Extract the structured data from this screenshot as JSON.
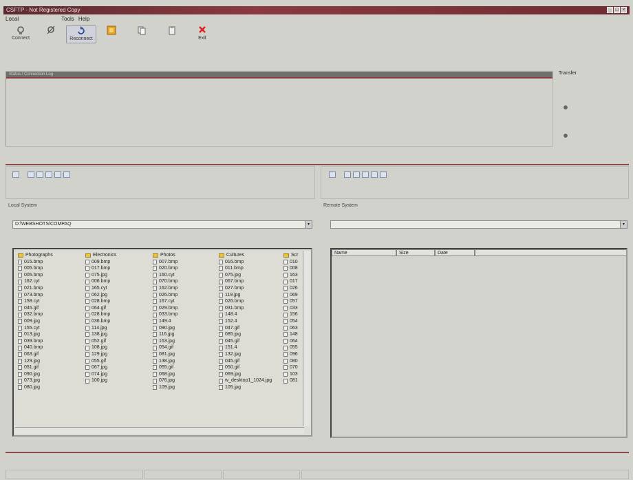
{
  "window": {
    "title": "CSFTP - Not Registered Copy"
  },
  "menu": [
    "Local",
    "Tools",
    "Help"
  ],
  "toolbar": [
    {
      "label": "Connect",
      "icon": "connect-icon"
    },
    {
      "label": "",
      "icon": "disconnect-icon"
    },
    {
      "label": "Reconnect",
      "icon": "reconnect-icon"
    },
    {
      "label": "",
      "icon": "stop-icon"
    },
    {
      "label": "",
      "icon": "copy-icon"
    },
    {
      "label": "",
      "icon": "paste-icon"
    },
    {
      "label": "Exit",
      "icon": "exit-icon"
    }
  ],
  "status": {
    "header": "Status / Connection Log"
  },
  "transfer": {
    "label": "Transfer"
  },
  "local": {
    "label": "Local System",
    "path": "D:\\WEBSHOTS\\COMPAQ",
    "columns": [
      {
        "items": [
          {
            "name": "Photographs",
            "type": "folder"
          },
          {
            "name": "015.bmp"
          },
          {
            "name": "005.bmp"
          },
          {
            "name": "005.bmp"
          },
          {
            "name": "162.cyt"
          },
          {
            "name": "021.bmp"
          },
          {
            "name": "073.bmp"
          },
          {
            "name": "158.cyt"
          },
          {
            "name": "045.gif"
          },
          {
            "name": "032.bmp"
          },
          {
            "name": "009.jpg"
          },
          {
            "name": "155.cyt"
          },
          {
            "name": "013.jpg"
          },
          {
            "name": "039.bmp"
          },
          {
            "name": "040.bmp"
          },
          {
            "name": "063.gif"
          },
          {
            "name": "129.jpg"
          },
          {
            "name": "051.gif"
          },
          {
            "name": "090.jpg"
          },
          {
            "name": "073.jpg"
          },
          {
            "name": "080.jpg"
          }
        ]
      },
      {
        "items": [
          {
            "name": "Electronics",
            "type": "folder"
          },
          {
            "name": "009.bmp"
          },
          {
            "name": "017.bmp"
          },
          {
            "name": "075.jpg"
          },
          {
            "name": "006.bmp"
          },
          {
            "name": "165.cyt"
          },
          {
            "name": "062.jpg"
          },
          {
            "name": "028.bmp"
          },
          {
            "name": "064.gif"
          },
          {
            "name": "028.bmp"
          },
          {
            "name": "036.bmp"
          },
          {
            "name": "114.jpg"
          },
          {
            "name": "138.jpg"
          },
          {
            "name": "052.gif"
          },
          {
            "name": "108.jpg"
          },
          {
            "name": "129.jpg"
          },
          {
            "name": "055.gif"
          },
          {
            "name": "067.jpg"
          },
          {
            "name": "074.jpg"
          },
          {
            "name": "100.jpg"
          }
        ]
      },
      {
        "items": [
          {
            "name": "Photos",
            "type": "folder"
          },
          {
            "name": "007.bmp"
          },
          {
            "name": "020.bmp"
          },
          {
            "name": "160.cyt"
          },
          {
            "name": "070.bmp"
          },
          {
            "name": "162.bmp"
          },
          {
            "name": "026.bmp"
          },
          {
            "name": "167.cyt"
          },
          {
            "name": "029.bmp"
          },
          {
            "name": "033.bmp"
          },
          {
            "name": "149.4"
          },
          {
            "name": "090.jpg"
          },
          {
            "name": "116.jpg"
          },
          {
            "name": "163.jpg"
          },
          {
            "name": "054.gif"
          },
          {
            "name": "081.jpg"
          },
          {
            "name": "138.jpg"
          },
          {
            "name": "055.gif"
          },
          {
            "name": "068.jpg"
          },
          {
            "name": "076.jpg"
          },
          {
            "name": "109.jpg"
          }
        ]
      },
      {
        "items": [
          {
            "name": "Cultures",
            "type": "folder"
          },
          {
            "name": "016.bmp"
          },
          {
            "name": "011.bmp"
          },
          {
            "name": "075.jpg"
          },
          {
            "name": "067.bmp"
          },
          {
            "name": "027.bmp"
          },
          {
            "name": "119.jpg"
          },
          {
            "name": "026.bmp"
          },
          {
            "name": "031.bmp"
          },
          {
            "name": "148.4"
          },
          {
            "name": "152.4"
          },
          {
            "name": "047.gif"
          },
          {
            "name": "085.jpg"
          },
          {
            "name": "045.gif"
          },
          {
            "name": "151.4"
          },
          {
            "name": "132.jpg"
          },
          {
            "name": "045.gif"
          },
          {
            "name": "050.gif"
          },
          {
            "name": "069.jpg"
          },
          {
            "name": "w_desktop1_1024.jpg"
          },
          {
            "name": "105.jpg"
          }
        ]
      },
      {
        "items": [
          {
            "name": "Scr",
            "type": "folder"
          },
          {
            "name": "010"
          },
          {
            "name": "008"
          },
          {
            "name": "163"
          },
          {
            "name": "017"
          },
          {
            "name": "026"
          },
          {
            "name": "069"
          },
          {
            "name": "057"
          },
          {
            "name": "033"
          },
          {
            "name": "156"
          },
          {
            "name": "054"
          },
          {
            "name": "063"
          },
          {
            "name": "148"
          },
          {
            "name": "064"
          },
          {
            "name": "055"
          },
          {
            "name": "096"
          },
          {
            "name": "080"
          },
          {
            "name": "070"
          },
          {
            "name": "103"
          },
          {
            "name": "081"
          }
        ]
      }
    ]
  },
  "remote": {
    "label": "Remote System",
    "path": "",
    "headers": [
      "Name",
      "Size",
      "Date"
    ]
  },
  "statusbar": [
    "",
    "",
    "",
    ""
  ]
}
